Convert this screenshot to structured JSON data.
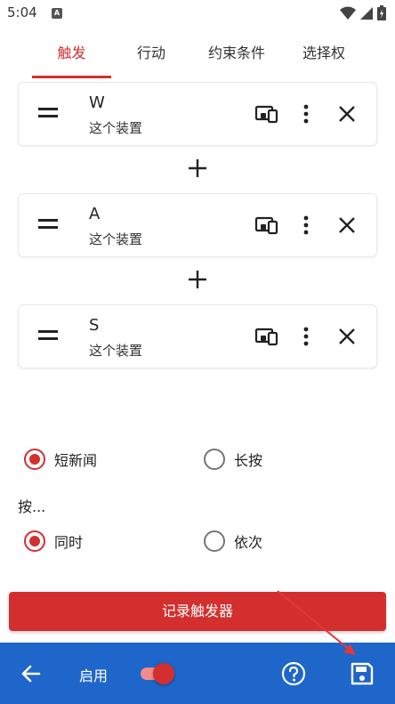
{
  "status_bar": {
    "time": "5:04",
    "app_icon_letter": "A"
  },
  "tabs": [
    {
      "label": "触发",
      "active": true
    },
    {
      "label": "行动",
      "active": false
    },
    {
      "label": "约束条件",
      "active": false
    },
    {
      "label": "选择权",
      "active": false
    }
  ],
  "triggers": [
    {
      "key": "W",
      "device": "这个装置"
    },
    {
      "key": "A",
      "device": "这个装置"
    },
    {
      "key": "S",
      "device": "这个装置"
    }
  ],
  "click_type": {
    "options": [
      {
        "label": "短新闻",
        "checked": true
      },
      {
        "label": "长按",
        "checked": false
      }
    ]
  },
  "press_section": {
    "label": "按...",
    "options": [
      {
        "label": "同时",
        "checked": true
      },
      {
        "label": "依次",
        "checked": false
      }
    ]
  },
  "record_button": {
    "label": "记录触发器"
  },
  "bottom_bar": {
    "enable_label": "启用",
    "enabled": true
  },
  "colors": {
    "accent": "#d32f2f",
    "bottom_bar": "#1e66c9"
  }
}
